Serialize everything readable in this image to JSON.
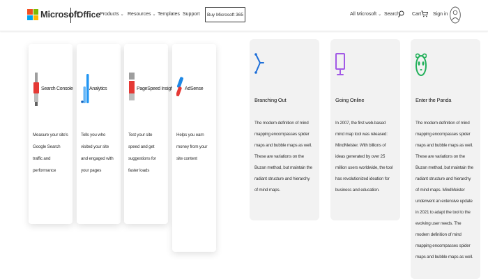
{
  "header": {
    "brand": "Microsoft",
    "office": "Office",
    "products": "Products",
    "resources": "Resources",
    "templates": "Templates",
    "support": "Support",
    "buy_button": "Buy Microsoft 365",
    "all_microsoft": "All Microsoft",
    "search": "Search",
    "cart": "Cart",
    "sign_in": "Sign in"
  },
  "tools": [
    {
      "title": "Search Console",
      "desc": "Measure your site's Google Search traffic and performance",
      "icon": "search-console-icon"
    },
    {
      "title": "Analytics",
      "desc": "Tells you who visited your site and engaged with your pages",
      "icon": "analytics-icon"
    },
    {
      "title": "PageSpeed Insights",
      "desc": "Test your site speed and get suggestions for faster loads",
      "icon": "pagespeed-icon"
    },
    {
      "title": "AdSense",
      "desc": "Helps you earn money from your site content",
      "icon": "adsense-icon"
    }
  ],
  "features": [
    {
      "title": "Branching Out",
      "icon": "branching-icon",
      "text": "The modern definition of mind mapping encompasses spider maps and bubble maps as well. These are variations on the Buzan method, but maintain the radiant structure and hierarchy of mind maps."
    },
    {
      "title": "Going Online",
      "icon": "monitor-icon",
      "text": "In 2007, the first web-based mind map tool was released: MindMeister. With billions of ideas generated by over 25 million users worldwide, the tool has revolutionized ideation for business and education."
    },
    {
      "title": "Enter the Panda",
      "icon": "panda-icon",
      "text": "The modern definition of mind mapping encompasses spider maps and bubble maps as well. These are variations on the Buzan method, but maintain the radiant structure and hierarchy of mind maps. MindMeister underwent an extensive update in 2021 to adapt the tool to the evolving user needs. The modern definition of mind mapping encompasses spider maps and bubble maps as well."
    }
  ],
  "colors": {
    "logo_red": "#f25022",
    "logo_green": "#7fba00",
    "logo_blue": "#00a4ef",
    "logo_yellow": "#ffb900",
    "branch_blue": "#1e6fd9",
    "monitor_purple": "#a259e6",
    "panda_green": "#22b05a"
  }
}
